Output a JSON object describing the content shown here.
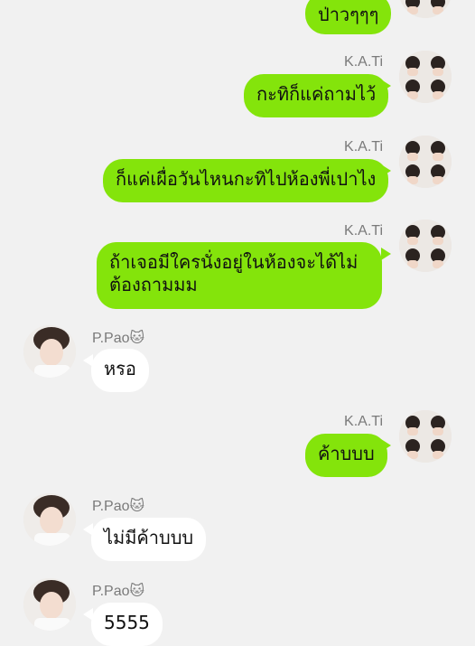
{
  "messages": [
    {
      "text": "ป่าวๆๆๆ"
    },
    {
      "sender": "K.A.Ti",
      "text": "กะทิก็แค่ถามไว้"
    },
    {
      "sender": "K.A.Ti",
      "text": "ก็แค่เผื่อวันไหนกะทิไปห้องพี่เปาไง"
    },
    {
      "sender": "K.A.Ti",
      "text": "ถ้าเจอมีใครนั่งอยู่ในห้องจะได้ไม่\nต้องถามมม"
    },
    {
      "sender": "P.Pao",
      "sender_emoji": "🐱",
      "text": "หรอ"
    },
    {
      "sender": "K.A.Ti",
      "text": "ค้าบบบ"
    },
    {
      "sender": "P.Pao",
      "sender_emoji": "🐱",
      "text": "ไม่มีค้าบบบ"
    },
    {
      "sender": "P.Pao",
      "sender_emoji": "🐱",
      "text": "5555"
    }
  ],
  "colors": {
    "background": "#f1f1f1",
    "outgoing_bubble": "#84e40b",
    "incoming_bubble": "#ffffff",
    "sender_name": "#7a7a7a"
  }
}
